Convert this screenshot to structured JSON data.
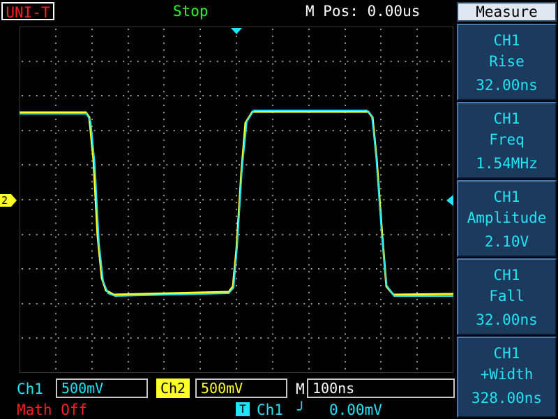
{
  "header": {
    "logo": "UNI-T",
    "status": "Stop",
    "m_pos": "M Pos: 0.00us"
  },
  "measure": {
    "title": "Measure",
    "items": [
      {
        "channel": "CH1",
        "name": "Rise",
        "value": "32.00ns"
      },
      {
        "channel": "CH1",
        "name": "Freq",
        "value": "1.54MHz"
      },
      {
        "channel": "CH1",
        "name": "Amplitude",
        "value": "2.10V"
      },
      {
        "channel": "CH1",
        "name": "Fall",
        "value": "32.00ns"
      },
      {
        "channel": "CH1",
        "name": "+Width",
        "value": "328.00ns"
      }
    ]
  },
  "screen": {
    "ch2_marker": "2"
  },
  "footer": {
    "ch1_label": "Ch1",
    "ch1_scale": "500mV",
    "ch2_label": "Ch2",
    "ch2_scale": "500mV",
    "m_label": "M",
    "timebase": "100ns",
    "math_status": "Math Off",
    "trigger_icon": "T",
    "trigger_source": "Ch1",
    "trigger_slope": "╯",
    "trigger_level": "0.00mV"
  },
  "colors": {
    "ch1": "#22e4f6",
    "ch2": "#ffff2a",
    "status": "#26ff2a",
    "math": "#ff2020",
    "panel": "#1c3a5c"
  }
}
